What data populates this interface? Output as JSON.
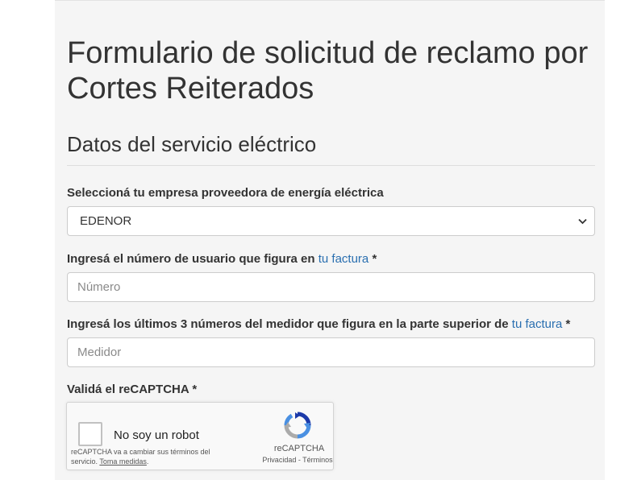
{
  "page": {
    "title": "Formulario de solicitud de reclamo por Cortes Reiterados",
    "section_title": "Datos del servicio eléctrico"
  },
  "provider": {
    "label": "Seleccioná tu empresa proveedora de energía eléctrica",
    "selected": "EDENOR"
  },
  "user_number": {
    "label": "Ingresá el número de usuario que figura en ",
    "link": "tu factura",
    "required": " *",
    "placeholder": "Número",
    "value": ""
  },
  "meter": {
    "label": "Ingresá los últimos 3 números del medidor que figura en la parte superior de ",
    "link": "tu factura",
    "required": " *",
    "placeholder": "Medidor",
    "value": ""
  },
  "captcha": {
    "label": "Validá el reCAPTCHA *",
    "checkbox_label": "No soy un robot",
    "notice_text": "reCAPTCHA va a cambiar sus términos del servicio. ",
    "notice_link": "Toma medidas",
    "notice_end": ".",
    "brand": "reCAPTCHA",
    "links": "Privacidad - Términos",
    "icon": "recaptcha-logo-icon"
  },
  "colors": {
    "link": "#2a6fb0",
    "panel_bg": "#f5f5f5",
    "text": "#333333"
  }
}
